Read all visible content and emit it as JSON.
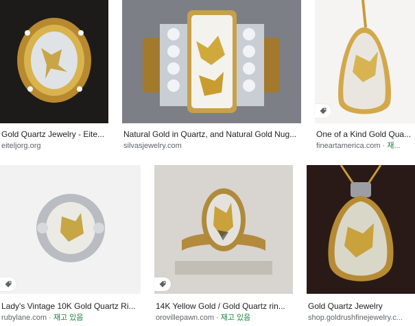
{
  "results": [
    {
      "title": "Gold Quartz Jewelry - Eite...",
      "source": "eiteljorg.org",
      "stock": ""
    },
    {
      "title": "Natural Gold in Quartz, and Natural Gold Nug...",
      "source": "silvasjewelry.com",
      "stock": ""
    },
    {
      "title": "One of a Kind Gold Qua...",
      "source": "fineartamerica.com · ",
      "stock": "재..."
    },
    {
      "title": "Lady's Vintage 10K Gold Quartz Ri...",
      "source": "rubylane.com · ",
      "stock": "재고 있음"
    },
    {
      "title": "14K Yellow Gold / Gold Quartz rin...",
      "source": "orovillepawn.com · ",
      "stock": "재고 있음"
    },
    {
      "title": "Gold Quartz Jewelry",
      "source": "shop.goldrushfinejewelry.c...",
      "stock": ""
    }
  ],
  "icons": {
    "product_tag": "price-tag-icon"
  }
}
